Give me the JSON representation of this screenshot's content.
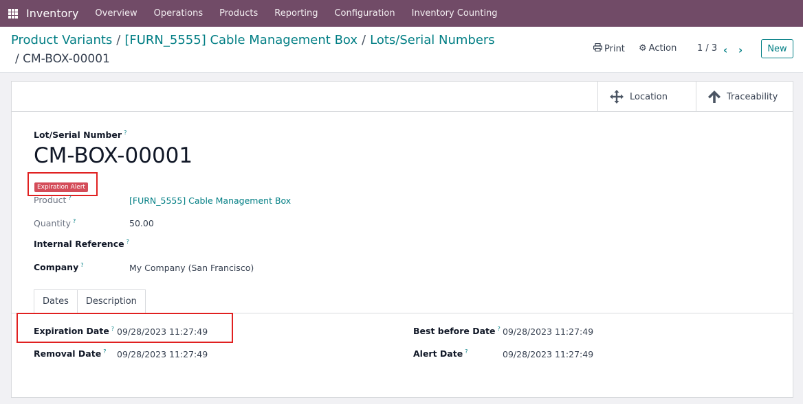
{
  "navbar": {
    "app_name": "Inventory",
    "menu": [
      "Overview",
      "Operations",
      "Products",
      "Reporting",
      "Configuration",
      "Inventory Counting"
    ]
  },
  "breadcrumb": {
    "items": [
      "Product Variants",
      "[FURN_5555] Cable Management Box",
      "Lots/Serial Numbers"
    ],
    "current": "CM-BOX-00001",
    "separator": "/"
  },
  "toolbar": {
    "print_label": "Print",
    "action_label": "Action",
    "pager": "1 / 3",
    "new_label": "New"
  },
  "smart_buttons": {
    "location_label": "Location",
    "traceability_label": "Traceability"
  },
  "form": {
    "lot_label": "Lot/Serial Number",
    "lot_name": "CM-BOX-00001",
    "badge": "Expiration Alert",
    "help_mark": "?",
    "product_label": "Product",
    "product_value": "[FURN_5555] Cable Management Box",
    "quantity_label": "Quantity",
    "quantity_value": "50.00",
    "internal_ref_label": "Internal Reference",
    "company_label": "Company",
    "company_value": "My Company (San Francisco)"
  },
  "tabs": [
    "Dates",
    "Description"
  ],
  "dates": {
    "expiration_label": "Expiration Date",
    "expiration_value": "09/28/2023 11:27:49",
    "removal_label": "Removal Date",
    "removal_value": "09/28/2023 11:27:49",
    "best_before_label": "Best before Date",
    "best_before_value": "09/28/2023 11:27:49",
    "alert_label": "Alert Date",
    "alert_value": "09/28/2023 11:27:49"
  },
  "colors": {
    "navbar": "#714b67",
    "link": "#017e84",
    "badge": "#d44c59",
    "highlight": "#e02020"
  }
}
